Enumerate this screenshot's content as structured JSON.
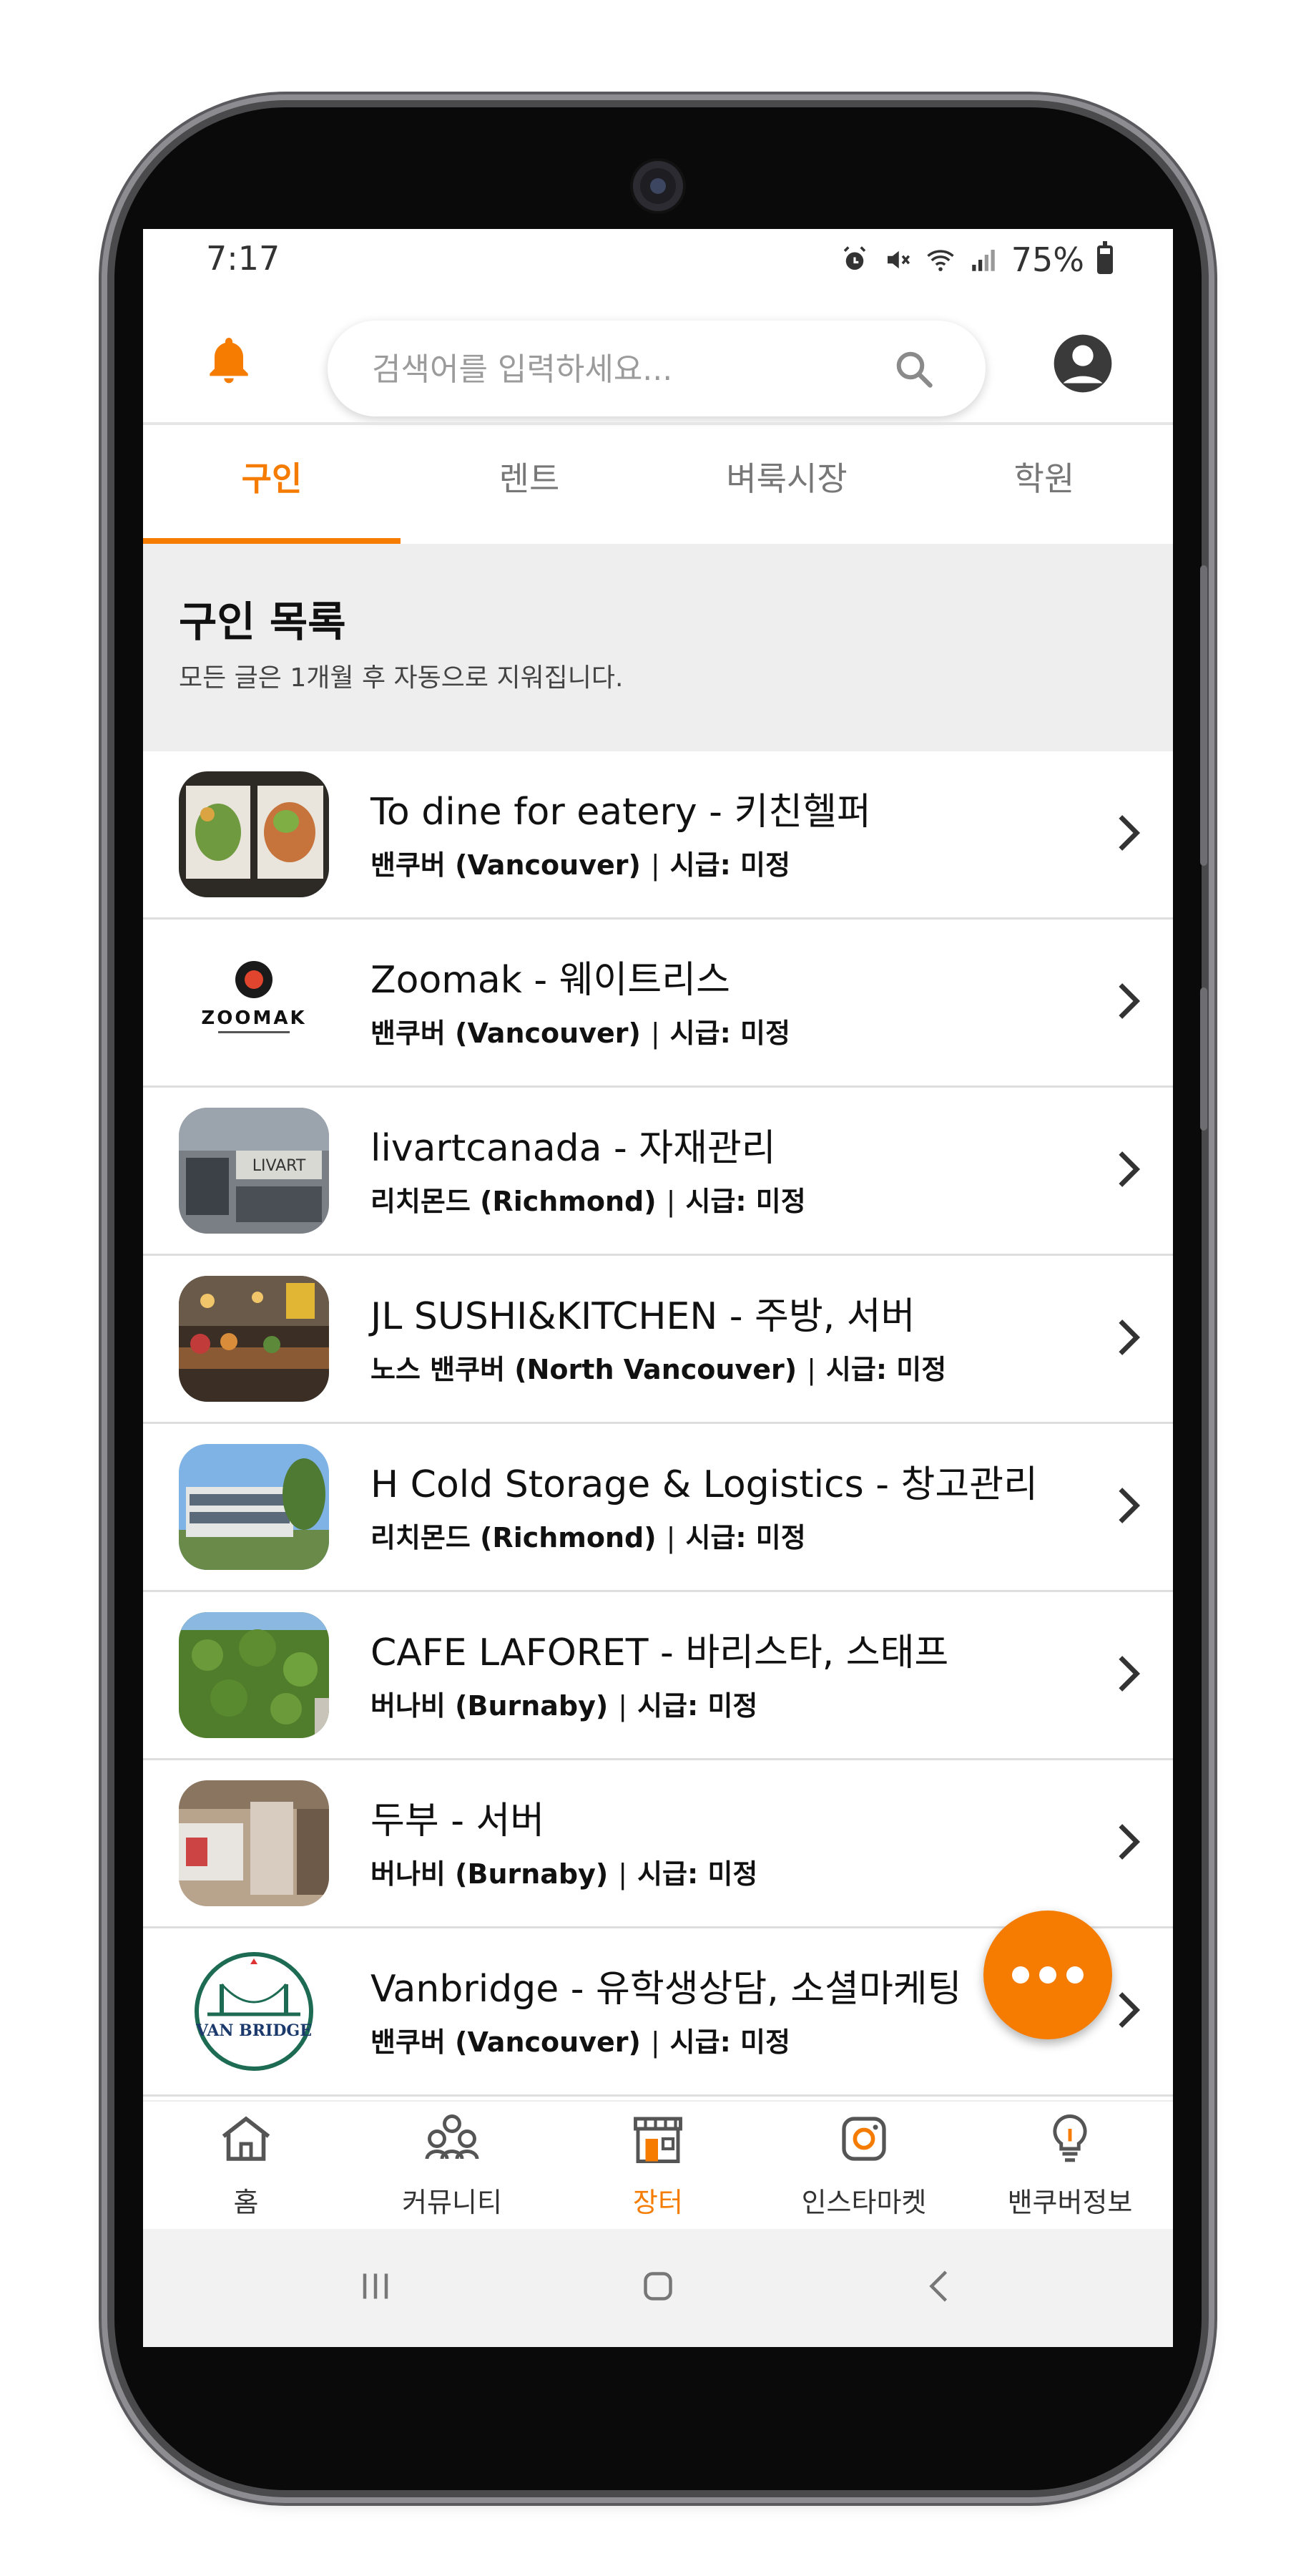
{
  "status_bar": {
    "time": "7:17",
    "battery": "75%"
  },
  "header": {
    "search_placeholder": "검색어를 입력하세요..."
  },
  "tabs": [
    {
      "label": "구인",
      "active": true
    },
    {
      "label": "렌트",
      "active": false
    },
    {
      "label": "벼룩시장",
      "active": false
    },
    {
      "label": "학원",
      "active": false
    }
  ],
  "list_header": {
    "title": "구인 목록",
    "subtitle": "모든 글은 1개월 후 자동으로 지워집니다."
  },
  "listings": [
    {
      "title": "To dine for eatery - 키친헬퍼",
      "location": "밴쿠버 (Vancouver)",
      "wage": "시급: 미정"
    },
    {
      "title": "Zoomak - 웨이트리스",
      "location": "밴쿠버 (Vancouver)",
      "wage": "시급: 미정",
      "logo_text": "ZOOMAK"
    },
    {
      "title": "livartcanada - 자재관리",
      "location": "리치몬드 (Richmond)",
      "wage": "시급: 미정"
    },
    {
      "title": "JL SUSHI&KITCHEN - 주방, 서버",
      "location": "노스 밴쿠버 (North Vancouver)",
      "wage": "시급: 미정"
    },
    {
      "title": "H Cold Storage & Logistics - 창고관리",
      "location": "리치몬드 (Richmond)",
      "wage": "시급: 미정"
    },
    {
      "title": "CAFE LAFORET - 바리스타, 스태프",
      "location": "버나비 (Burnaby)",
      "wage": "시급: 미정"
    },
    {
      "title": "두부 - 서버",
      "location": "버나비 (Burnaby)",
      "wage": "시급: 미정"
    },
    {
      "title": "Vanbridge - 유학생상담, 소셜마케팅",
      "location": "밴쿠버 (Vancouver)",
      "wage": "시급: 미정",
      "logo_text": "VAN BRIDGE"
    }
  ],
  "bottom_nav": [
    {
      "label": "홈",
      "icon": "home-icon",
      "active": false
    },
    {
      "label": "커뮤니티",
      "icon": "community-icon",
      "active": false
    },
    {
      "label": "장터",
      "icon": "store-icon",
      "active": true
    },
    {
      "label": "인스타마켓",
      "icon": "instagram-icon",
      "active": false
    },
    {
      "label": "밴쿠버정보",
      "icon": "lightbulb-icon",
      "active": false
    }
  ],
  "colors": {
    "accent": "#f57c00",
    "text": "#111111",
    "muted": "#777777",
    "section_bg": "#eeeeee"
  }
}
